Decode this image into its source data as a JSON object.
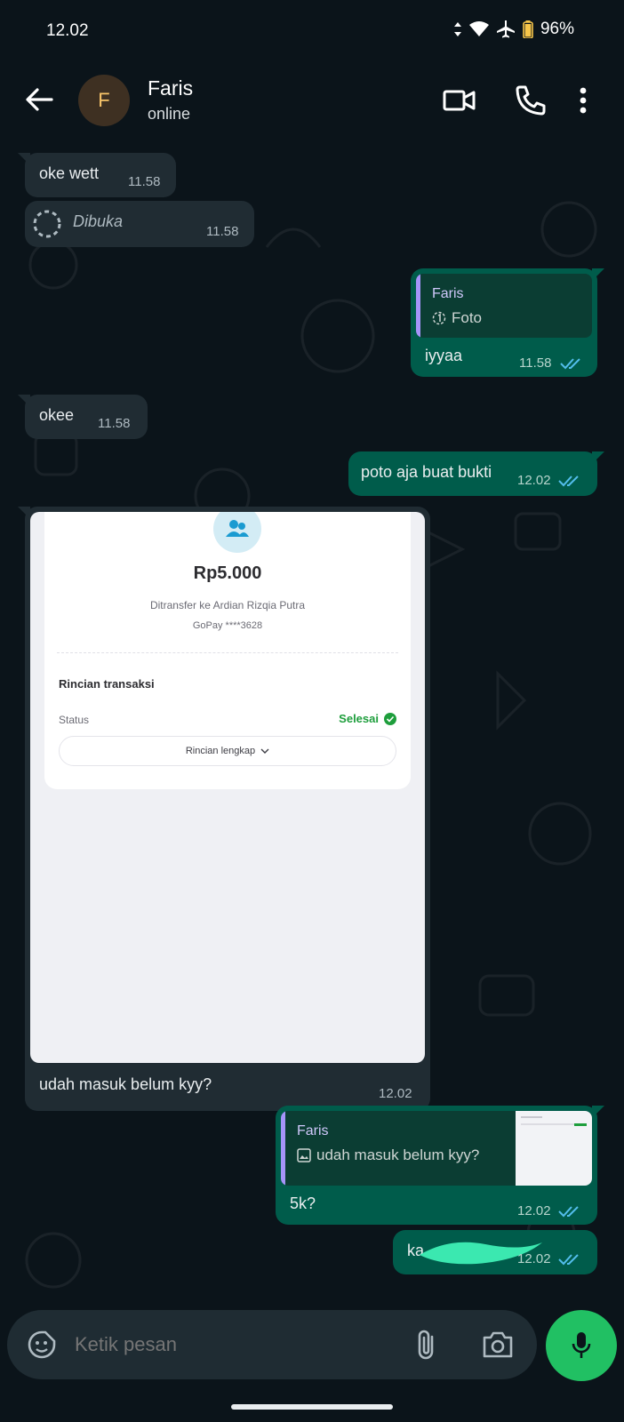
{
  "status_bar": {
    "time": "12.02",
    "battery": "96%"
  },
  "header": {
    "avatar_letter": "F",
    "name": "Faris",
    "status": "online"
  },
  "messages": {
    "m1": {
      "text": "oke wett",
      "time": "11.58"
    },
    "m2": {
      "text": "Dibuka",
      "time": "11.58"
    },
    "m3": {
      "quote_name": "Faris",
      "quote_text": "Foto",
      "text": "iyyaa",
      "time": "11.58"
    },
    "m4": {
      "text": "okee",
      "time": "11.58"
    },
    "m5": {
      "text": "poto aja buat bukti",
      "time": "12.02"
    },
    "m6": {
      "caption": "udah masuk belum kyy?",
      "time": "12.02"
    },
    "m7": {
      "quote_name": "Faris",
      "quote_text": "udah masuk belum kyy?",
      "text": "5k?",
      "time": "12.02"
    },
    "m8": {
      "text": "ka",
      "time": "12.02"
    }
  },
  "receipt": {
    "amount": "Rp5.000",
    "transfer_to": "Ditransfer ke Ardian Rizqia Putra",
    "account": "GoPay ****3628",
    "section_title": "Rincian transaksi",
    "status_label": "Status",
    "status_value": "Selesai",
    "details_button": "Rincian lengkap"
  },
  "input": {
    "placeholder": "Ketik pesan"
  },
  "colors": {
    "background": "#0b141a",
    "incoming_bubble": "#202c33",
    "outgoing_bubble": "#005c4b",
    "accent_green": "#21c063",
    "read_tick": "#53bdeb",
    "quote_bar": "#a594f9",
    "redaction": "#3be8b0"
  },
  "icons": [
    "back-arrow-icon",
    "video-call-icon",
    "phone-icon",
    "more-vert-icon",
    "sticker-icon",
    "attach-icon",
    "camera-icon",
    "mic-icon",
    "double-check-icon",
    "view-once-icon",
    "image-icon"
  ]
}
